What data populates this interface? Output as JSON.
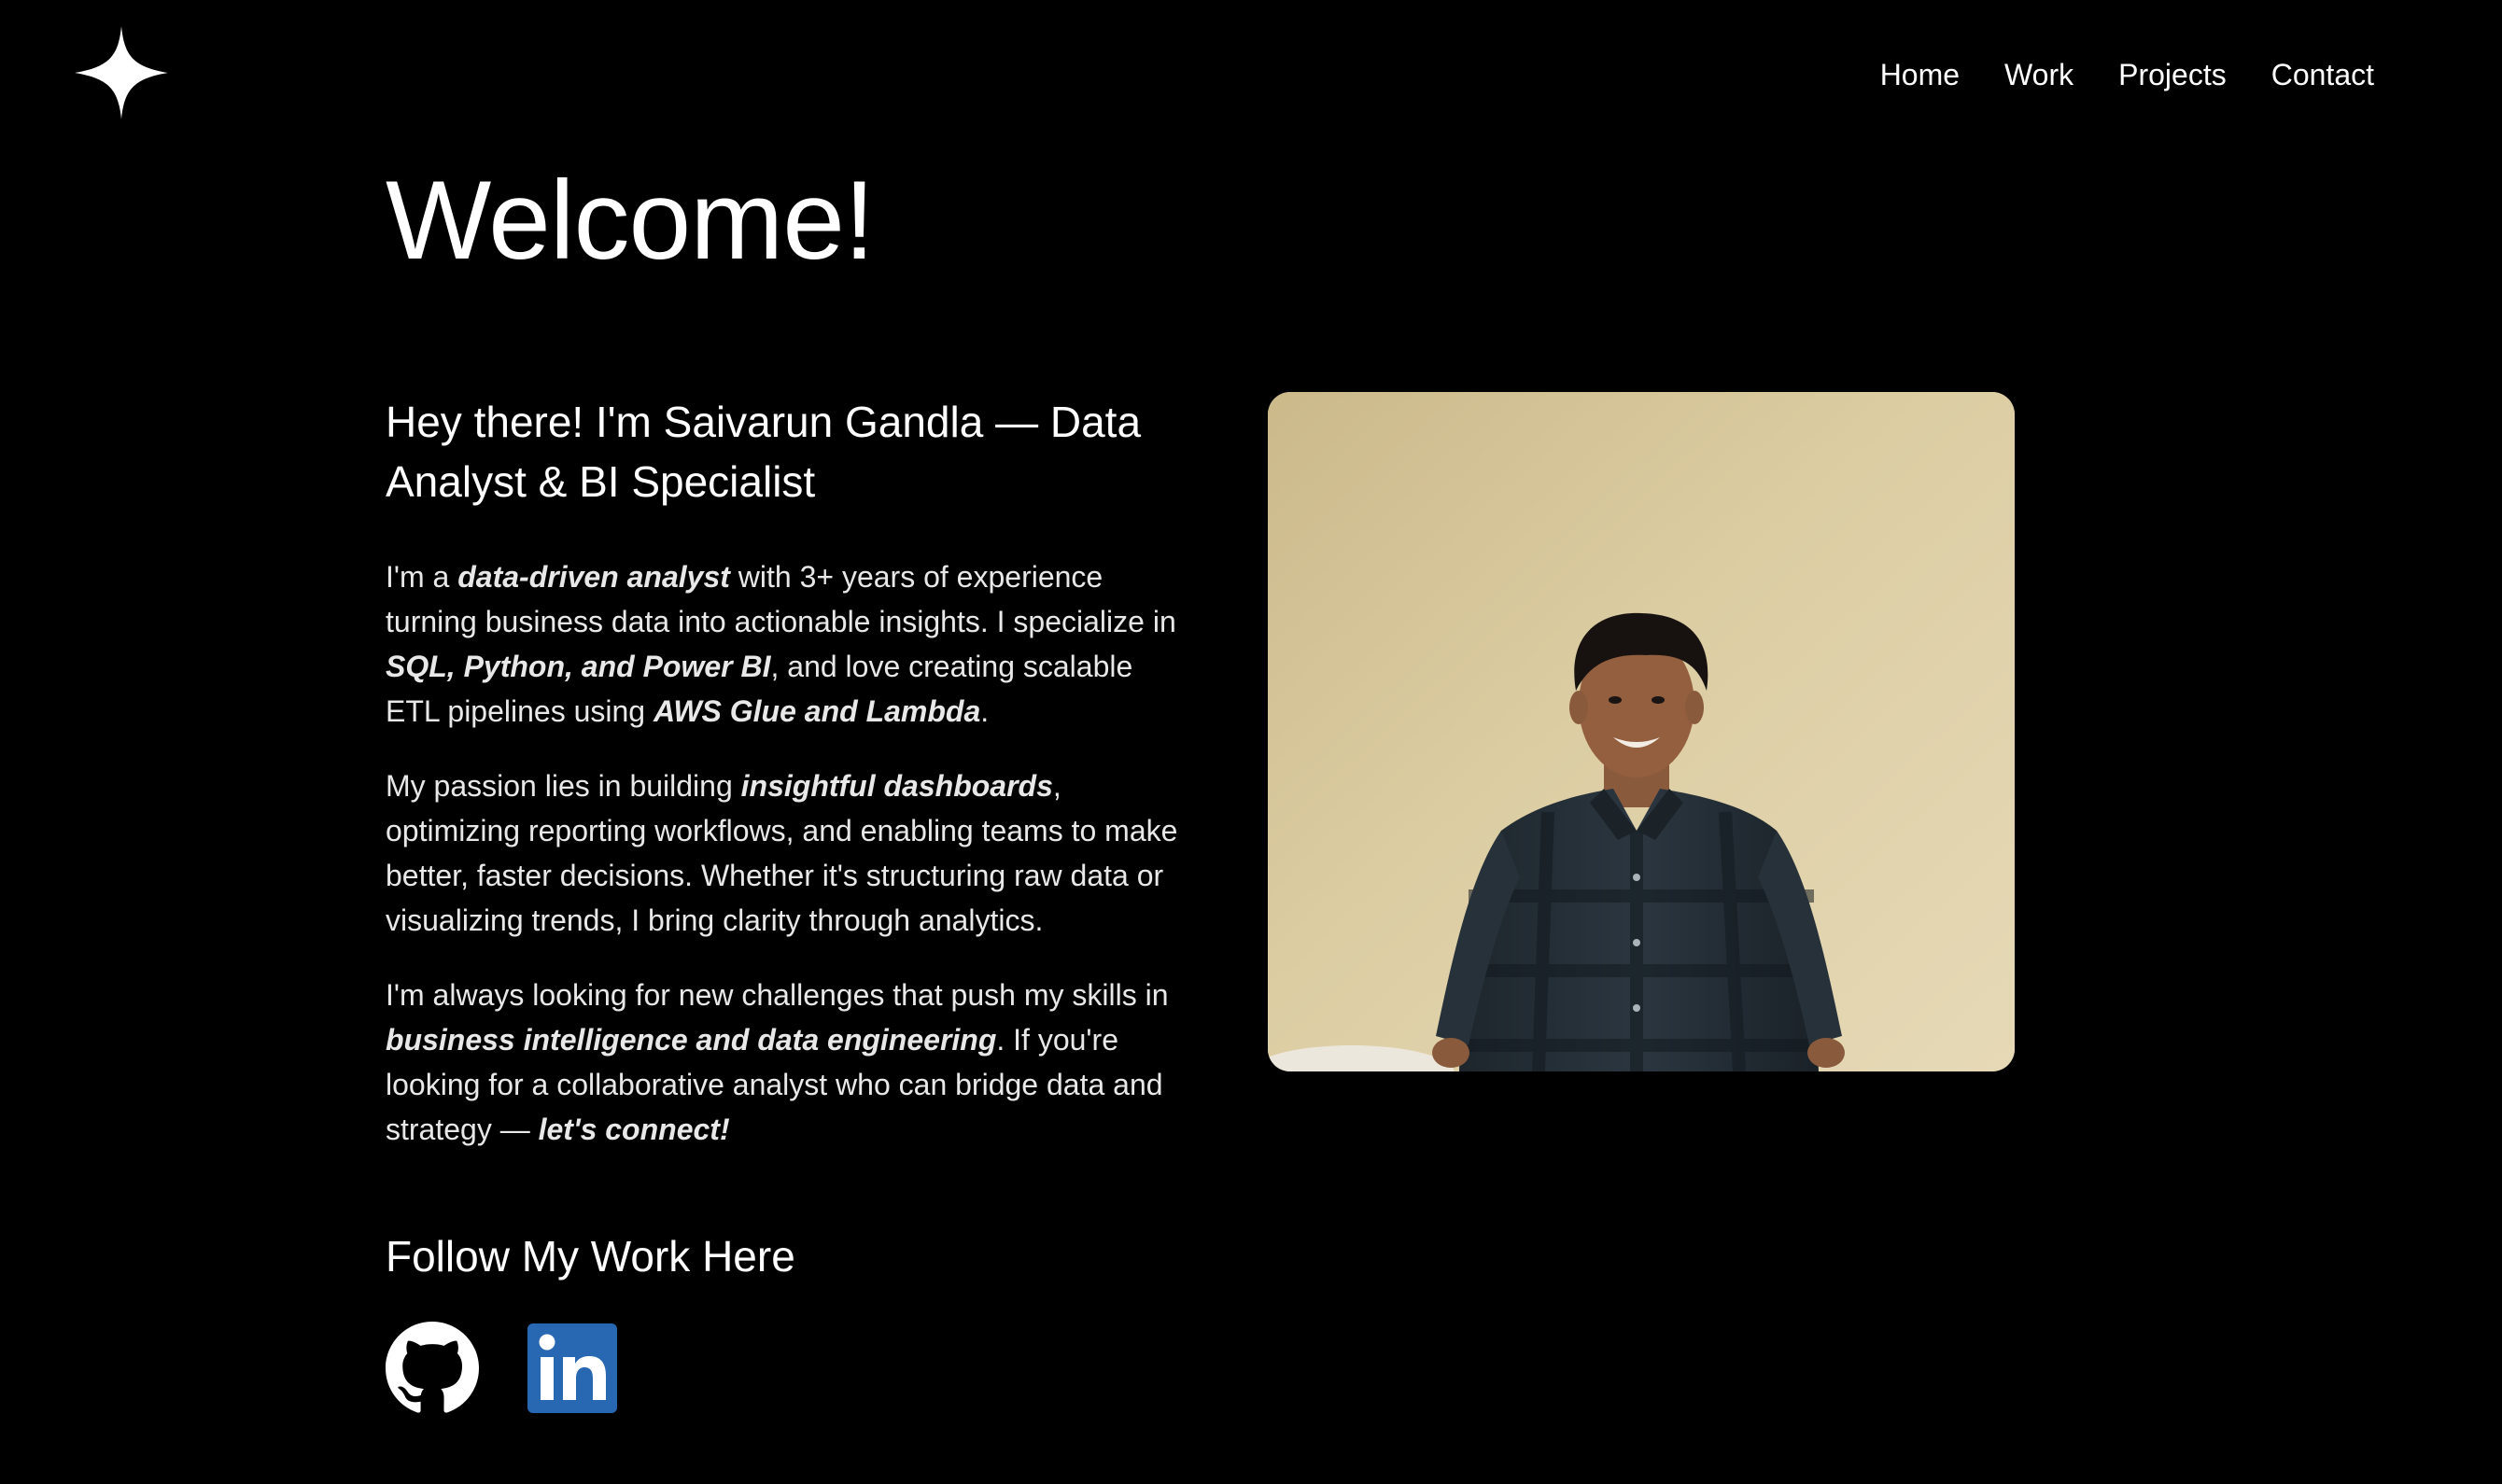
{
  "nav": {
    "items": [
      {
        "label": "Home"
      },
      {
        "label": "Work"
      },
      {
        "label": "Projects"
      },
      {
        "label": "Contact"
      }
    ]
  },
  "logo": {
    "icon": "four-point-star-icon"
  },
  "main": {
    "title": "Welcome!",
    "intro_heading": "Hey there! I'm Saivarun Gandla — Data Analyst & BI Specialist",
    "paragraphs": {
      "p1": {
        "t1": "I'm a ",
        "e1": "data-driven analyst",
        "t2": " with 3+ years of experience turning business data into actionable insights. I specialize in ",
        "e2": "SQL, Python, and Power BI",
        "t3": ", and love creating scalable ETL pipelines using ",
        "e3": "AWS Glue and Lambda",
        "t4": "."
      },
      "p2": {
        "t1": "My passion lies in building ",
        "e1": "insightful dashboards",
        "t2": ", optimizing reporting workflows, and enabling teams to make better, faster decisions. Whether it's structuring raw data or visualizing trends, I bring clarity through analytics."
      },
      "p3": {
        "t1": "I'm always looking for new challenges that push my skills in ",
        "e1": "business intelligence and data engineering",
        "t2": ". If you're looking for a collaborative analyst who can bridge data and strategy — ",
        "e2": "let's connect!"
      }
    },
    "follow_heading": "Follow My Work Here",
    "socials": [
      {
        "icon": "github-icon"
      },
      {
        "icon": "linkedin-icon"
      }
    ]
  },
  "colors": {
    "background": "#000000",
    "text": "#ffffff",
    "linkedin": "#2867b2"
  }
}
